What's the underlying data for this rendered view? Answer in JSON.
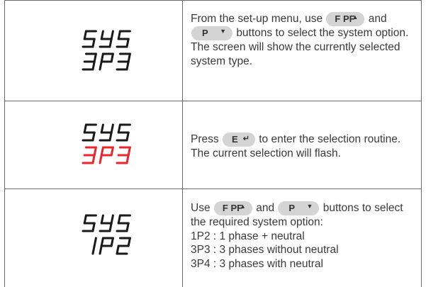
{
  "rows": [
    {
      "display": {
        "line1": "SYS",
        "line2": "3P3",
        "line2_color": "#1a1a1a"
      },
      "text": {
        "p1": "From the set-up menu, use",
        "p2": "and",
        "p3": "buttons to select the system option. The screen will show the currently selected system type."
      }
    },
    {
      "display": {
        "line1": "SYS",
        "line2": "3P3",
        "line2_color": "#e8262b"
      },
      "text": {
        "p1": "Press",
        "p2": "to enter the selection routine. The current selection will flash."
      }
    },
    {
      "display": {
        "line1": "SYS",
        "line2": "1P2",
        "line2_color": "#1a1a1a"
      },
      "text": {
        "p1": "Use",
        "p2": "and",
        "p3": "buttons to select the required system option:",
        "options": [
          "1P2 : 1 phase + neutral",
          "3P3 : 3 phases without neutral",
          "3P4 : 3 phases with neutral"
        ]
      }
    }
  ],
  "buttons": {
    "fpf": {
      "label": "F PF",
      "arrow": "▲",
      "icon": "up-arrow-icon"
    },
    "p": {
      "label": "P",
      "arrow": "▼",
      "icon": "down-arrow-icon"
    },
    "e": {
      "label": "E",
      "arrow": "↵",
      "icon": "enter-arrow-icon"
    }
  },
  "colors": {
    "border": "#6b6b6b",
    "button_bg": "#d4d4d4",
    "highlight": "#e8262b",
    "display": "#1a1a1a"
  }
}
